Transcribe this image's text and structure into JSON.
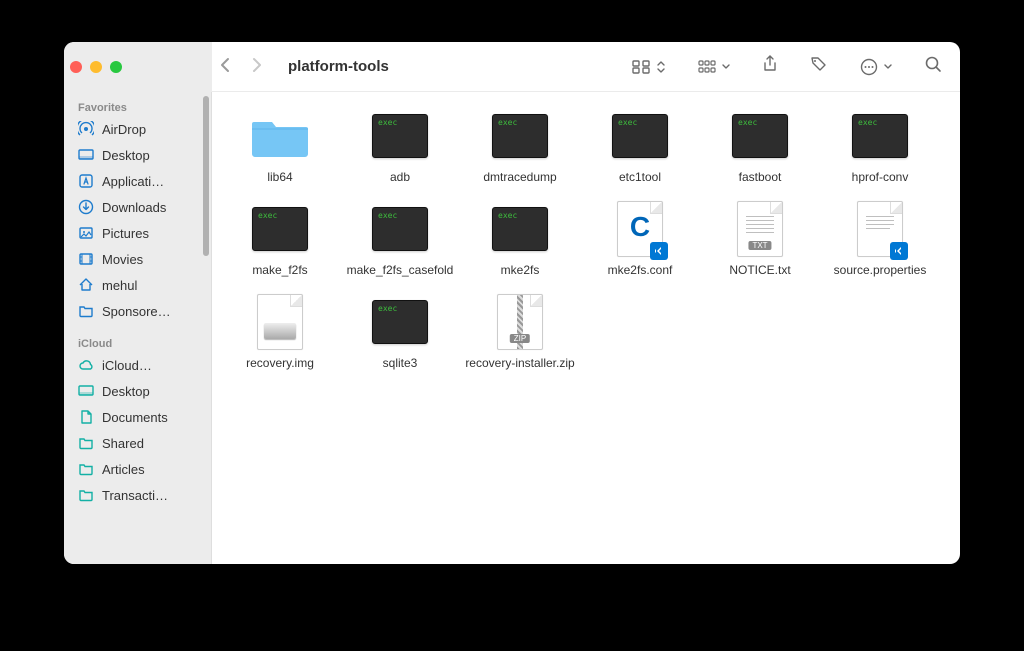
{
  "window": {
    "title": "platform-tools"
  },
  "sidebar": {
    "sections": [
      {
        "label": "Favorites",
        "items": [
          {
            "icon": "airdrop",
            "label": "AirDrop"
          },
          {
            "icon": "desktop",
            "label": "Desktop"
          },
          {
            "icon": "applications",
            "label": "Applicati…"
          },
          {
            "icon": "downloads",
            "label": "Downloads"
          },
          {
            "icon": "pictures",
            "label": "Pictures"
          },
          {
            "icon": "movies",
            "label": "Movies"
          },
          {
            "icon": "home",
            "label": "mehul"
          },
          {
            "icon": "folder",
            "label": "Sponsore…"
          }
        ]
      },
      {
        "label": "iCloud",
        "items": [
          {
            "icon": "cloud",
            "label": "iCloud…"
          },
          {
            "icon": "desktop",
            "label": "Desktop"
          },
          {
            "icon": "documents",
            "label": "Documents"
          },
          {
            "icon": "shared",
            "label": "Shared"
          },
          {
            "icon": "folder",
            "label": "Articles"
          },
          {
            "icon": "folder",
            "label": "Transacti…"
          }
        ]
      }
    ]
  },
  "files": [
    {
      "name": "lib64",
      "type": "folder"
    },
    {
      "name": "adb",
      "type": "exec"
    },
    {
      "name": "dmtracedump",
      "type": "exec"
    },
    {
      "name": "etc1tool",
      "type": "exec"
    },
    {
      "name": "fastboot",
      "type": "exec"
    },
    {
      "name": "hprof-conv",
      "type": "exec"
    },
    {
      "name": "make_f2fs",
      "type": "exec"
    },
    {
      "name": "make_f2fs_casefold",
      "type": "exec"
    },
    {
      "name": "mke2fs",
      "type": "exec"
    },
    {
      "name": "mke2fs.conf",
      "type": "vscode-c"
    },
    {
      "name": "NOTICE.txt",
      "type": "txt"
    },
    {
      "name": "source.properties",
      "type": "vscode"
    },
    {
      "name": "recovery.img",
      "type": "img"
    },
    {
      "name": "sqlite3",
      "type": "exec"
    },
    {
      "name": "recovery-installer.zip",
      "type": "zip"
    }
  ],
  "badges": {
    "txt": "TXT",
    "zip": "ZIP"
  }
}
